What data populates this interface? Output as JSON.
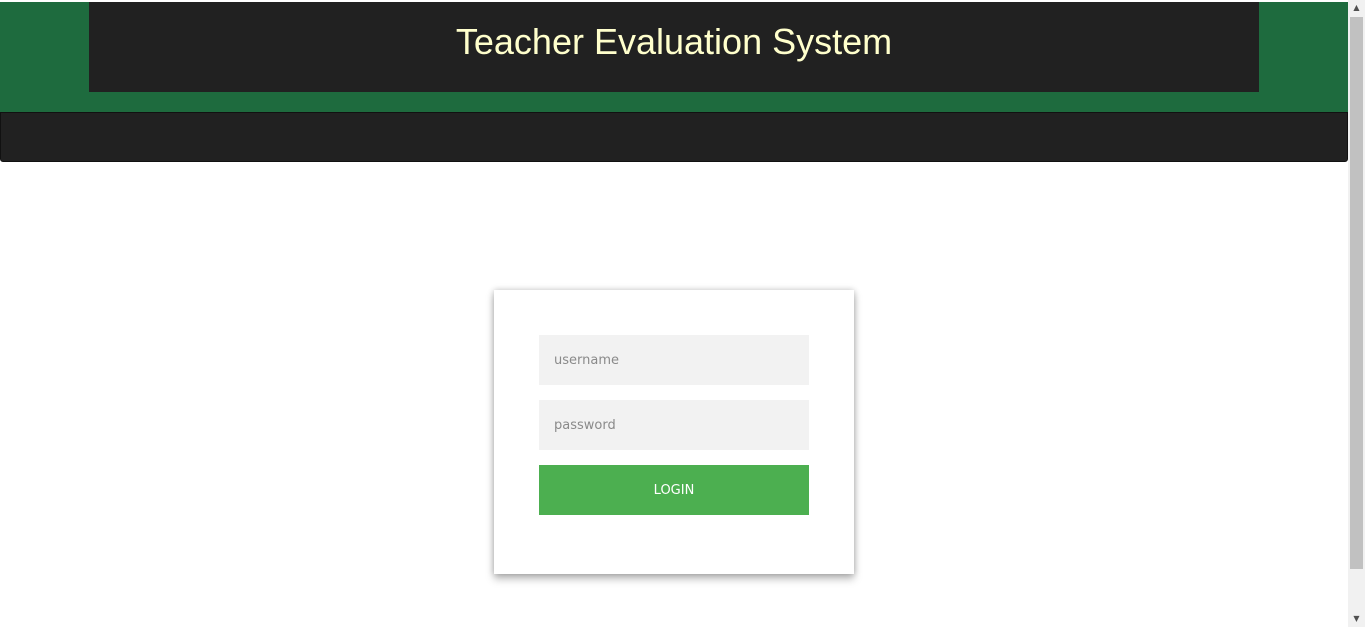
{
  "header": {
    "title": "Teacher Evaluation System"
  },
  "login": {
    "username_placeholder": "username",
    "password_placeholder": "password",
    "button_label": "LOGIN"
  },
  "scrollbar": {
    "up_arrow": "▲",
    "down_arrow": "▼"
  },
  "colors": {
    "header_band": "#1e6b3e",
    "header_box": "#212121",
    "title_text": "#ffffcc",
    "navbar": "#212121",
    "input_background": "#f2f2f2",
    "login_button": "#4caf50"
  }
}
